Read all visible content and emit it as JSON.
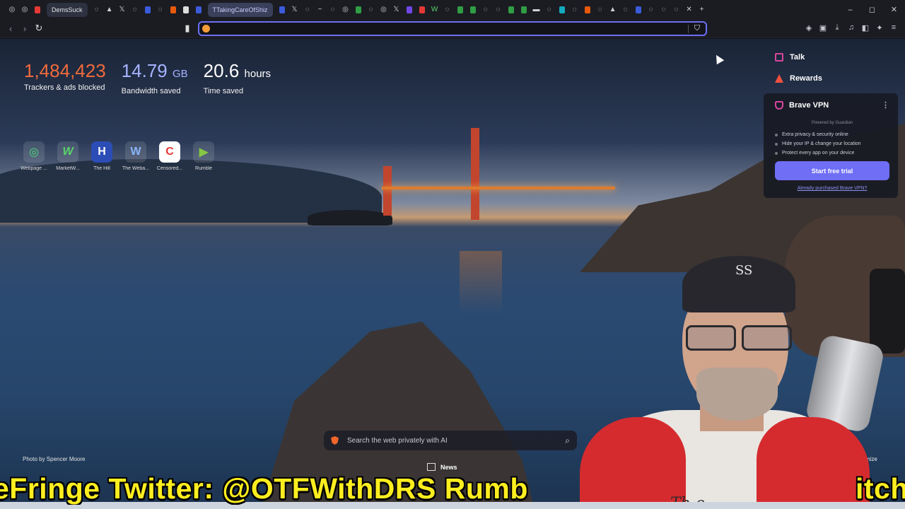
{
  "browser": {
    "tabs": [
      {
        "label": "DemsSuck",
        "state": "active"
      },
      {
        "label": "TTakingCareOfShiz",
        "state": "highlight"
      }
    ],
    "toolbar": {
      "back_icon": "back-arrow-icon",
      "forward_icon": "forward-arrow-icon",
      "reload_icon": "reload-icon",
      "bookmark_icon": "bookmark-icon"
    },
    "address": {
      "value": "",
      "placeholder": ""
    }
  },
  "stats": {
    "trackers": {
      "value": "1,484,423",
      "label": "Trackers & ads blocked"
    },
    "bandwidth": {
      "value": "14.79",
      "unit": "GB",
      "label": "Bandwidth saved"
    },
    "time": {
      "value": "20.6",
      "unit": "hours",
      "label": "Time saved"
    }
  },
  "top_sites": [
    {
      "name": "Webpage ...",
      "glyph": "◎",
      "color": "#4caf7a"
    },
    {
      "name": "MarketW...",
      "glyph": "W",
      "color": "#5bd36b"
    },
    {
      "name": "The Hill",
      "glyph": "H",
      "color": "#2c4db5"
    },
    {
      "name": "The Weba...",
      "glyph": "W",
      "color": "#8ab4f8"
    },
    {
      "name": "Censored...",
      "glyph": "C",
      "color": "#e53935"
    },
    {
      "name": "Rumble",
      "glyph": "▶",
      "color": "#85c742"
    }
  ],
  "panel": {
    "talk": "Talk",
    "rewards": "Rewards",
    "vpn": {
      "title": "Brave VPN",
      "powered": "Powered by Guardian",
      "bullets": [
        "Extra privacy & security online",
        "Hide your IP & change your location",
        "Protect every app on your device"
      ],
      "cta": "Start free trial",
      "purchased": "Already purchased Brave VPN?"
    }
  },
  "search": {
    "placeholder": "Search the web privately with AI"
  },
  "footer": {
    "photo_credit": "Photo by Spencer Moore",
    "news": "News",
    "customize": "Customize"
  },
  "overlay": {
    "ticker": "eFringe Twitter: @OTFWithDRS Rumb",
    "ticker_right": "itch",
    "cap_logo": "SS",
    "shirt_text": "Th  c"
  },
  "colors": {
    "accent": "#6f6ef5",
    "trackers": "#f06a3c",
    "bandwidth": "#a6b3ff",
    "ticker": "#ffee1f"
  }
}
